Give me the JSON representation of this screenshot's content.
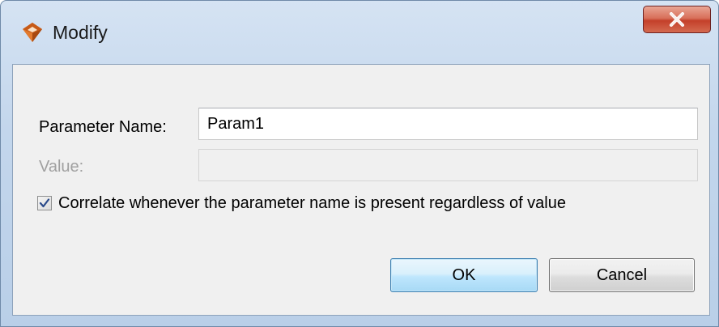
{
  "window": {
    "title": "Modify",
    "close_symbol": "x"
  },
  "form": {
    "parameter_name_label": "Parameter Name:",
    "parameter_name_value": "Param1",
    "value_label": "Value:",
    "value_value": "",
    "value_enabled": false,
    "correlate_checked": true,
    "correlate_label": "Correlate whenever the parameter name is present regardless of value"
  },
  "buttons": {
    "ok_label": "OK",
    "cancel_label": "Cancel"
  },
  "icons": {
    "app": "app-logo-icon",
    "close": "close-icon",
    "check": "checkmark-icon"
  },
  "colors": {
    "titlebar": "#c3d6ec",
    "close_button": "#c4402a",
    "ok_border": "#3c7fb1",
    "checkmark": "#2a4a8a",
    "disabled_text": "#a0a0a0"
  }
}
